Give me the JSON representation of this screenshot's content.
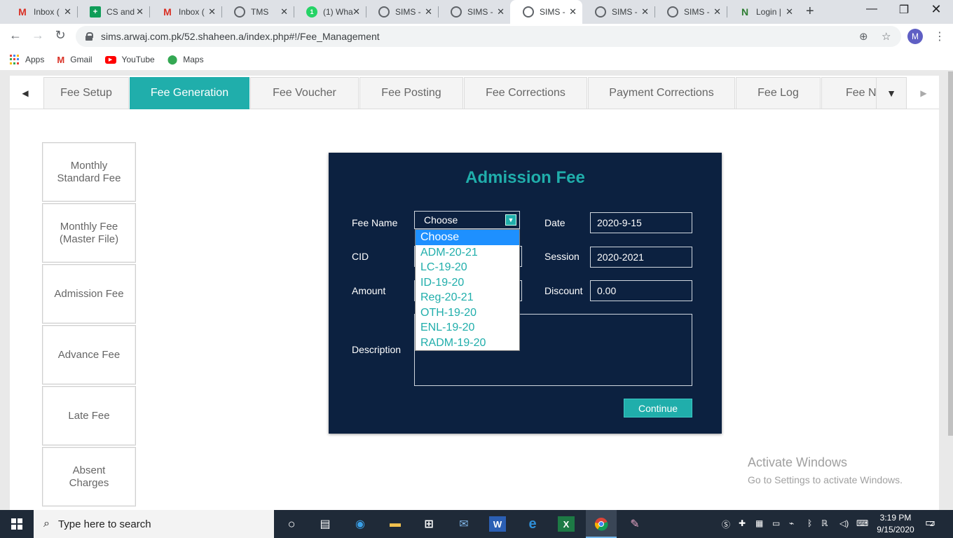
{
  "browser": {
    "tabs": [
      {
        "title": "Inbox (",
        "icon": "gmail-icon"
      },
      {
        "title": "CS and",
        "icon": "sheets-icon"
      },
      {
        "title": "Inbox (",
        "icon": "gmail-icon"
      },
      {
        "title": "TMS",
        "icon": "globe-icon"
      },
      {
        "title": "(1) Wha",
        "icon": "whatsapp-icon"
      },
      {
        "title": "SIMS -",
        "icon": "globe-icon"
      },
      {
        "title": "SIMS -",
        "icon": "globe-icon"
      },
      {
        "title": "SIMS -",
        "icon": "globe-icon"
      },
      {
        "title": "SIMS -",
        "icon": "globe-icon"
      },
      {
        "title": "SIMS -",
        "icon": "globe-icon"
      },
      {
        "title": "Login |",
        "icon": "n-icon"
      }
    ],
    "url": "sims.arwaj.com.pk/52.shaheen.a/index.php#!/Fee_Management",
    "profile_initial": "M",
    "bookmarks": [
      "Apps",
      "Gmail",
      "YouTube",
      "Maps"
    ]
  },
  "fee_tabs": {
    "items": [
      "Fee Setup",
      "Fee Generation",
      "Fee Voucher",
      "Fee Posting",
      "Fee Corrections",
      "Payment Corrections",
      "Fee Log",
      "Fee N"
    ],
    "active": "Fee Generation"
  },
  "sidebar": {
    "items": [
      "Monthly Standard Fee",
      "Monthly Fee (Master File)",
      "Admission Fee",
      "Advance Fee",
      "Late Fee",
      "Absent Charges"
    ]
  },
  "form": {
    "title": "Admission Fee",
    "fee_name_label": "Fee Name",
    "fee_name_value": "Choose",
    "cid_label": "CID",
    "amount_label": "Amount",
    "description_label": "Description",
    "date_label": "Date",
    "date_value": "2020-9-15",
    "session_label": "Session",
    "session_value": "2020-2021",
    "discount_label": "Discount",
    "discount_value": "0.00",
    "continue_label": "Continue",
    "dropdown_options": [
      "Choose",
      "ADM-20-21",
      "LC-19-20",
      "ID-19-20",
      "Reg-20-21",
      "OTH-19-20",
      "ENL-19-20",
      "RADM-19-20"
    ],
    "dropdown_selected": "Choose"
  },
  "watermark": {
    "line1": "Activate Windows",
    "line2": "Go to Settings to activate Windows."
  },
  "taskbar": {
    "search_placeholder": "Type here to search",
    "time": "3:19 PM",
    "date": "9/15/2020",
    "notification_count": "2"
  },
  "colors": {
    "accent": "#20aeab",
    "panel_bg": "#0c2140",
    "dropdown_highlight": "#1e90ff"
  }
}
